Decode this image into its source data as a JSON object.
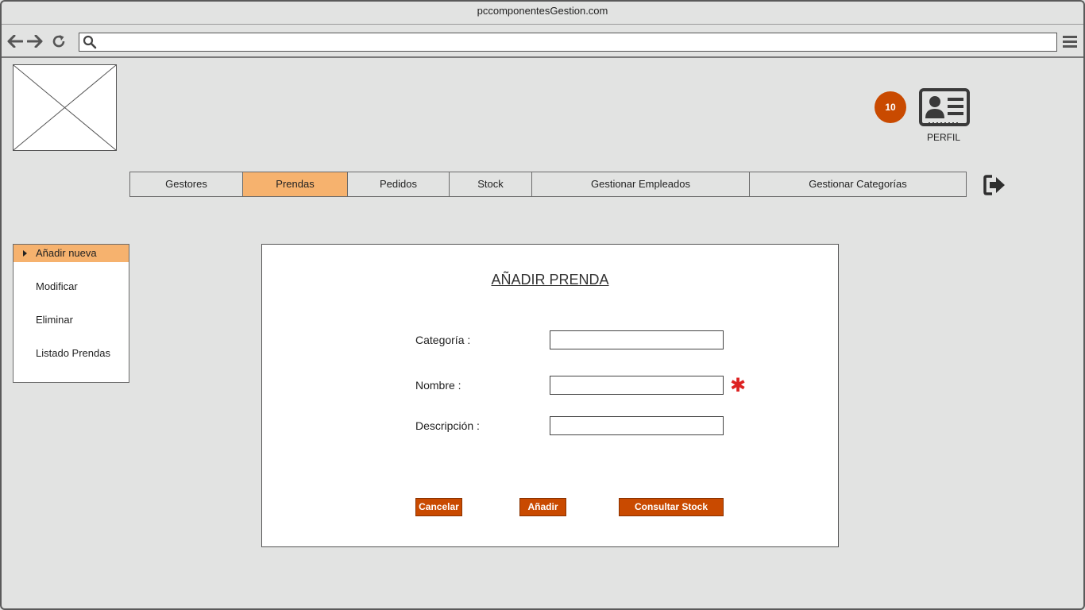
{
  "window": {
    "title": "pccomponentesGestion.com"
  },
  "browser": {
    "back_icon": "arrow-left-icon",
    "forward_icon": "arrow-right-icon",
    "reload_icon": "reload-icon",
    "search_icon": "search-icon",
    "menu_icon": "hamburger-menu-icon",
    "url_value": ""
  },
  "header": {
    "notification_count": "10",
    "profile_label": "PERFIL",
    "accent_color": "#c94a00"
  },
  "menu": {
    "tabs": [
      {
        "label": "Gestores",
        "active": false
      },
      {
        "label": "Prendas",
        "active": true
      },
      {
        "label": "Pedidos",
        "active": false
      },
      {
        "label": "Stock",
        "active": false
      },
      {
        "label": "Gestionar Empleados",
        "active": false
      },
      {
        "label": "Gestionar Categorías",
        "active": false
      }
    ],
    "active_color": "#f6b26e"
  },
  "sidebar": {
    "items": [
      {
        "label": "Añadir nueva",
        "active": true
      },
      {
        "label": "Modificar",
        "active": false
      },
      {
        "label": "Eliminar",
        "active": false
      },
      {
        "label": "Listado Prendas",
        "active": false
      }
    ]
  },
  "form": {
    "title": "AÑADIR PRENDA",
    "fields": [
      {
        "label": "Categoría :",
        "value": ""
      },
      {
        "label": "Nombre :",
        "value": "",
        "required_mark": "✱"
      },
      {
        "label": "Descripción :",
        "value": ""
      }
    ],
    "buttons": {
      "cancel": "Cancelar",
      "add": "Añadir",
      "stock": "Consultar Stock"
    }
  }
}
